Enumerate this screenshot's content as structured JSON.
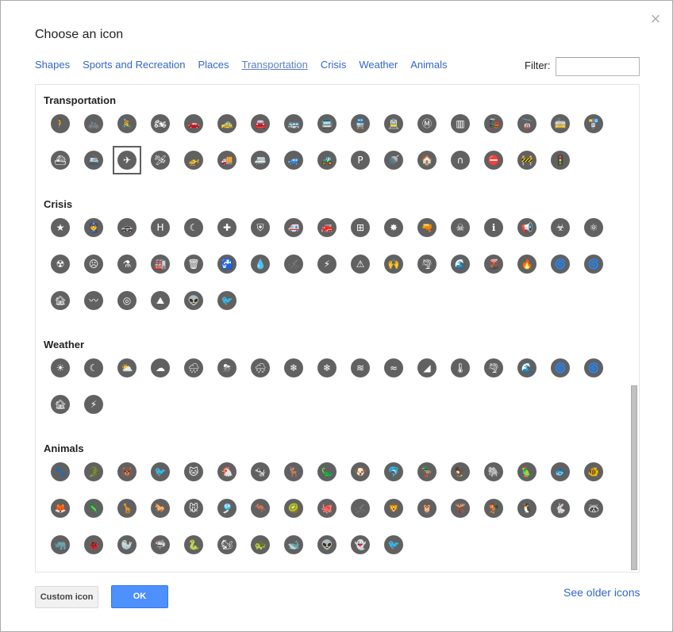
{
  "dialog": {
    "title": "Choose an icon",
    "close_glyph": "×",
    "filter_label": "Filter:",
    "filter_value": "",
    "tabs": [
      {
        "label": "Shapes"
      },
      {
        "label": "Sports and Recreation"
      },
      {
        "label": "Places"
      },
      {
        "label": "Transportation"
      },
      {
        "label": "Crisis"
      },
      {
        "label": "Weather"
      },
      {
        "label": "Animals"
      }
    ],
    "active_tab": "Transportation",
    "custom_button": "Custom icon",
    "ok_button": "OK",
    "older_link": "See older icons"
  },
  "colors": {
    "icon_bg": "#616161",
    "link": "#3366cc",
    "ok": "#4d90fe"
  },
  "sections": [
    {
      "title": "Transportation",
      "icons": [
        {
          "name": "hiker-icon",
          "glyph": "🚶"
        },
        {
          "name": "bicycle-icon",
          "glyph": "🚲"
        },
        {
          "name": "cyclist-icon",
          "glyph": "🚴"
        },
        {
          "name": "motorcycle-icon",
          "glyph": "🏍"
        },
        {
          "name": "car-icon",
          "glyph": "🚗"
        },
        {
          "name": "taxi-icon",
          "glyph": "🚕"
        },
        {
          "name": "car-front-icon",
          "glyph": "🚘"
        },
        {
          "name": "bus-icon",
          "glyph": "🚌"
        },
        {
          "name": "bus-front-icon",
          "glyph": "🚍"
        },
        {
          "name": "train-icon",
          "glyph": "🚆"
        },
        {
          "name": "tram-icon",
          "glyph": "🚊"
        },
        {
          "name": "metro-icon",
          "glyph": "Ⓜ"
        },
        {
          "name": "rail-track-icon",
          "glyph": "▥"
        },
        {
          "name": "locomotive-icon",
          "glyph": "🚂"
        },
        {
          "name": "cable-car-icon",
          "glyph": "🚡"
        },
        {
          "name": "streetcar-icon",
          "glyph": "🚋"
        },
        {
          "name": "bus-stop-icon",
          "glyph": "🚏"
        },
        {
          "name": "ferry-icon",
          "glyph": "⛴"
        },
        {
          "name": "ship-icon",
          "glyph": "🚢"
        },
        {
          "name": "airplane-icon",
          "glyph": "✈",
          "selected": true
        },
        {
          "name": "small-plane-icon",
          "glyph": "🛩"
        },
        {
          "name": "helicopter-icon",
          "glyph": "🚁"
        },
        {
          "name": "truck-icon",
          "glyph": "🚚"
        },
        {
          "name": "rv-icon",
          "glyph": "🚐"
        },
        {
          "name": "camper-icon",
          "glyph": "🚙"
        },
        {
          "name": "tractor-icon",
          "glyph": "🚜"
        },
        {
          "name": "parking-icon",
          "glyph": "P"
        },
        {
          "name": "car-wash-icon",
          "glyph": "🚿"
        },
        {
          "name": "garage-icon",
          "glyph": "🏠"
        },
        {
          "name": "tunnel-icon",
          "glyph": "∩"
        },
        {
          "name": "road-closed-icon",
          "glyph": "⛔"
        },
        {
          "name": "construction-icon",
          "glyph": "🚧"
        },
        {
          "name": "traffic-light-icon",
          "glyph": "🚦"
        }
      ]
    },
    {
      "title": "Crisis",
      "icons": [
        {
          "name": "police-badge-icon",
          "glyph": "★"
        },
        {
          "name": "police-officer-icon",
          "glyph": "👮"
        },
        {
          "name": "police-car-icon",
          "glyph": "🚓"
        },
        {
          "name": "hospital-icon",
          "glyph": "H"
        },
        {
          "name": "crescent-icon",
          "glyph": "☾"
        },
        {
          "name": "red-cross-icon",
          "glyph": "✚"
        },
        {
          "name": "shield-cross-icon",
          "glyph": "⛨"
        },
        {
          "name": "ambulance-icon",
          "glyph": "🚑"
        },
        {
          "name": "fire-truck-icon",
          "glyph": "🚒"
        },
        {
          "name": "first-aid-icon",
          "glyph": "⊞"
        },
        {
          "name": "explosion-icon",
          "glyph": "✸"
        },
        {
          "name": "gun-icon",
          "glyph": "🔫"
        },
        {
          "name": "poison-icon",
          "glyph": "☠"
        },
        {
          "name": "info-person-icon",
          "glyph": "ℹ"
        },
        {
          "name": "megaphone-icon",
          "glyph": "📢"
        },
        {
          "name": "biohazard-icon",
          "glyph": "☣"
        },
        {
          "name": "atom-icon",
          "glyph": "⚛"
        },
        {
          "name": "radiation-icon",
          "glyph": "☢"
        },
        {
          "name": "gas-mask-icon",
          "glyph": "☹"
        },
        {
          "name": "flask-icon",
          "glyph": "⚗"
        },
        {
          "name": "factory-icon",
          "glyph": "🏭"
        },
        {
          "name": "trash-icon",
          "glyph": "🗑"
        },
        {
          "name": "faucet-icon",
          "glyph": "🚰"
        },
        {
          "name": "water-tap-icon",
          "glyph": "💧"
        },
        {
          "name": "mosquito-icon",
          "glyph": "🦟"
        },
        {
          "name": "electric-icon",
          "glyph": "⚡"
        },
        {
          "name": "warning-icon",
          "glyph": "⚠"
        },
        {
          "name": "helping-hands-icon",
          "glyph": "🙌"
        },
        {
          "name": "tornado-icon",
          "glyph": "🌪"
        },
        {
          "name": "tsunami-icon",
          "glyph": "🌊"
        },
        {
          "name": "volcano-icon",
          "glyph": "🌋"
        },
        {
          "name": "fire-icon",
          "glyph": "🔥"
        },
        {
          "name": "hurricane-icon",
          "glyph": "🌀"
        },
        {
          "name": "cyclone-icon",
          "glyph": "🌀"
        },
        {
          "name": "flood-icon",
          "glyph": "🏚"
        },
        {
          "name": "earthquake-icon",
          "glyph": "〰"
        },
        {
          "name": "target-icon",
          "glyph": "◎"
        },
        {
          "name": "landslide-icon",
          "glyph": "⛰"
        },
        {
          "name": "alien-icon",
          "glyph": "👽"
        },
        {
          "name": "dead-bird-icon",
          "glyph": "🐦"
        }
      ]
    },
    {
      "title": "Weather",
      "icons": [
        {
          "name": "sun-icon",
          "glyph": "☀"
        },
        {
          "name": "moon-cloud-icon",
          "glyph": "☾"
        },
        {
          "name": "partly-cloudy-icon",
          "glyph": "⛅"
        },
        {
          "name": "drizzle-icon",
          "glyph": "☁"
        },
        {
          "name": "rain-icon",
          "glyph": "🌧"
        },
        {
          "name": "thunderstorm-icon",
          "glyph": "⛈"
        },
        {
          "name": "sleet-icon",
          "glyph": "🌨"
        },
        {
          "name": "snow-cloud-icon",
          "glyph": "❄"
        },
        {
          "name": "snowflake-icon",
          "glyph": "❄"
        },
        {
          "name": "fog-icon",
          "glyph": "≋"
        },
        {
          "name": "wind-icon",
          "glyph": "≈"
        },
        {
          "name": "wave-shore-icon",
          "glyph": "◢"
        },
        {
          "name": "thermometer-icon",
          "glyph": "🌡"
        },
        {
          "name": "tornado-weather-icon",
          "glyph": "🌪"
        },
        {
          "name": "wave-icon",
          "glyph": "🌊"
        },
        {
          "name": "hurricane-weather-icon",
          "glyph": "🌀"
        },
        {
          "name": "cyclone-weather-icon",
          "glyph": "🌀"
        },
        {
          "name": "flood-weather-icon",
          "glyph": "🏚"
        },
        {
          "name": "lightning-icon",
          "glyph": "⚡"
        }
      ]
    },
    {
      "title": "Animals",
      "icons": [
        {
          "name": "paw-icon",
          "glyph": "🐾"
        },
        {
          "name": "crocodile-icon",
          "glyph": "🐊"
        },
        {
          "name": "bear-icon",
          "glyph": "🐻"
        },
        {
          "name": "bird-icon",
          "glyph": "🐦"
        },
        {
          "name": "cat-icon",
          "glyph": "🐱"
        },
        {
          "name": "chicken-icon",
          "glyph": "🐔"
        },
        {
          "name": "cow-icon",
          "glyph": "🐄"
        },
        {
          "name": "deer-icon",
          "glyph": "🦌"
        },
        {
          "name": "dinosaur-icon",
          "glyph": "🦕"
        },
        {
          "name": "dog-icon",
          "glyph": "🐶"
        },
        {
          "name": "dolphin-icon",
          "glyph": "🐬"
        },
        {
          "name": "duck-icon",
          "glyph": "🦆"
        },
        {
          "name": "eagle-icon",
          "glyph": "🦅"
        },
        {
          "name": "elephant-icon",
          "glyph": "🐘"
        },
        {
          "name": "parrot-icon",
          "glyph": "🦜"
        },
        {
          "name": "fish-icon",
          "glyph": "🐟"
        },
        {
          "name": "fish-alt-icon",
          "glyph": "🐠"
        },
        {
          "name": "fox-icon",
          "glyph": "🦊"
        },
        {
          "name": "gecko-icon",
          "glyph": "🦎"
        },
        {
          "name": "giraffe-icon",
          "glyph": "🦒"
        },
        {
          "name": "horse-icon",
          "glyph": "🐎"
        },
        {
          "name": "mouse-icon",
          "glyph": "🐭"
        },
        {
          "name": "jellyfish-icon",
          "glyph": "🎐"
        },
        {
          "name": "kangaroo-icon",
          "glyph": "🦘"
        },
        {
          "name": "kiwi-icon",
          "glyph": "🥝"
        },
        {
          "name": "octopus-icon",
          "glyph": "🐙"
        },
        {
          "name": "insect-icon",
          "glyph": "🦟"
        },
        {
          "name": "lion-icon",
          "glyph": "🦁"
        },
        {
          "name": "owl-icon",
          "glyph": "🦉"
        },
        {
          "name": "moose-icon",
          "glyph": "🫎"
        },
        {
          "name": "rooster-icon",
          "glyph": "🐓"
        },
        {
          "name": "penguin-icon",
          "glyph": "🐧"
        },
        {
          "name": "rabbit-icon",
          "glyph": "🐇"
        },
        {
          "name": "raccoon-icon",
          "glyph": "🦝"
        },
        {
          "name": "rhino-icon",
          "glyph": "🦏"
        },
        {
          "name": "beetle-icon",
          "glyph": "🐞"
        },
        {
          "name": "seal-icon",
          "glyph": "🦭"
        },
        {
          "name": "shark-icon",
          "glyph": "🦈"
        },
        {
          "name": "snake-icon",
          "glyph": "🐍"
        },
        {
          "name": "squirrel-icon",
          "glyph": "🐿"
        },
        {
          "name": "turtle-icon",
          "glyph": "🐢"
        },
        {
          "name": "whale-icon",
          "glyph": "🐋"
        },
        {
          "name": "alien-animal-icon",
          "glyph": "👽"
        },
        {
          "name": "ghost-icon",
          "glyph": "👻"
        },
        {
          "name": "sick-bird-icon",
          "glyph": "🐦"
        }
      ]
    }
  ]
}
